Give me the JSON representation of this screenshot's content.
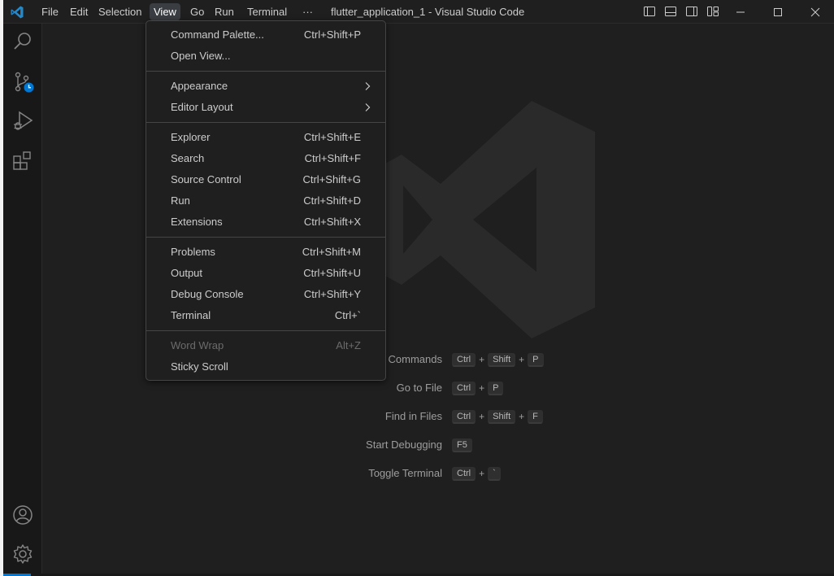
{
  "window": {
    "title": "flutter_application_1 - Visual Studio Code",
    "colors": {
      "background": "#1f1f1f",
      "accent": "#0078d4",
      "menu_border": "#454545"
    }
  },
  "menubar": {
    "items": [
      {
        "label": "File"
      },
      {
        "label": "Edit"
      },
      {
        "label": "Selection"
      },
      {
        "label": "View",
        "active": true
      },
      {
        "label": "Go"
      },
      {
        "label": "Run"
      },
      {
        "label": "Terminal"
      },
      {
        "label": "···"
      }
    ]
  },
  "titlebar_icons": [
    "toggle-primary-sidebar-icon",
    "toggle-panel-icon",
    "toggle-secondary-sidebar-icon",
    "customize-layout-icon"
  ],
  "window_controls": [
    "minimize-icon",
    "maximize-icon",
    "close-icon"
  ],
  "activitybar": {
    "top": [
      "search-icon",
      "source-control-icon",
      "run-debug-icon",
      "extensions-icon"
    ],
    "bottom": [
      "accounts-icon",
      "manage-gear-icon"
    ]
  },
  "view_menu": {
    "groups": [
      [
        {
          "label": "Command Palette...",
          "shortcut": "Ctrl+Shift+P"
        },
        {
          "label": "Open View...",
          "shortcut": ""
        }
      ],
      [
        {
          "label": "Appearance",
          "submenu": true
        },
        {
          "label": "Editor Layout",
          "submenu": true
        }
      ],
      [
        {
          "label": "Explorer",
          "shortcut": "Ctrl+Shift+E"
        },
        {
          "label": "Search",
          "shortcut": "Ctrl+Shift+F"
        },
        {
          "label": "Source Control",
          "shortcut": "Ctrl+Shift+G"
        },
        {
          "label": "Run",
          "shortcut": "Ctrl+Shift+D"
        },
        {
          "label": "Extensions",
          "shortcut": "Ctrl+Shift+X"
        }
      ],
      [
        {
          "label": "Problems",
          "shortcut": "Ctrl+Shift+M"
        },
        {
          "label": "Output",
          "shortcut": "Ctrl+Shift+U"
        },
        {
          "label": "Debug Console",
          "shortcut": "Ctrl+Shift+Y"
        },
        {
          "label": "Terminal",
          "shortcut": "Ctrl+`"
        }
      ],
      [
        {
          "label": "Word Wrap",
          "shortcut": "Alt+Z",
          "disabled": true
        },
        {
          "label": "Sticky Scroll",
          "shortcut": ""
        }
      ]
    ]
  },
  "watermark": {
    "hints": [
      {
        "label": "Commands",
        "keys": [
          "Ctrl",
          "Shift",
          "P"
        ]
      },
      {
        "label": "Go to File",
        "keys": [
          "Ctrl",
          "P"
        ]
      },
      {
        "label": "Find in Files",
        "keys": [
          "Ctrl",
          "Shift",
          "F"
        ]
      },
      {
        "label": "Start Debugging",
        "keys": [
          "F5"
        ]
      },
      {
        "label": "Toggle Terminal",
        "keys": [
          "Ctrl",
          "`"
        ]
      }
    ]
  }
}
